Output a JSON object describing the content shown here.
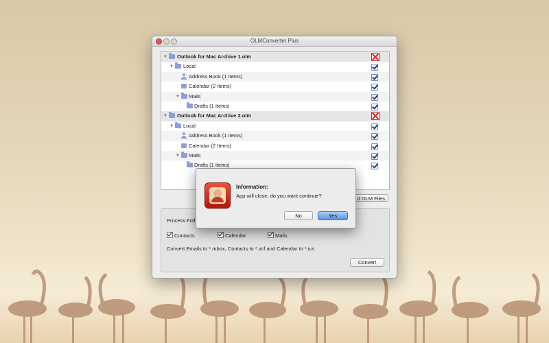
{
  "window": {
    "title": "OLMConverter Plus"
  },
  "tree": {
    "rows": [
      {
        "type": "archive",
        "label": "Outlook for Mac Archive 1.olm",
        "icon": "folder-icon",
        "expander": "▼"
      },
      {
        "type": "folder",
        "label": "Local",
        "icon": "folder-icon",
        "expander": "▼"
      },
      {
        "type": "item",
        "label": "Address Book (1 Items)",
        "icon": "person-icon"
      },
      {
        "type": "item",
        "label": "Calendar (2 Items)",
        "icon": "calendar-icon"
      },
      {
        "type": "folder",
        "label": "Mails",
        "icon": "folder-icon",
        "expander": "▼"
      },
      {
        "type": "item",
        "label": "Drafts (1 Items)",
        "icon": "folder-icon"
      },
      {
        "type": "archive",
        "label": "Outlook for Mac Archive 2.olm",
        "icon": "folder-icon",
        "expander": "▼"
      },
      {
        "type": "folder",
        "label": "Local",
        "icon": "folder-icon",
        "expander": "▼"
      },
      {
        "type": "item",
        "label": "Address Book (1 Items)",
        "icon": "person-icon"
      },
      {
        "type": "item",
        "label": "Calendar (2 Items)",
        "icon": "calendar-icon"
      },
      {
        "type": "folder",
        "label": "Mails",
        "icon": "folder-icon",
        "expander": "▼"
      },
      {
        "type": "item",
        "label": "Drafts (1 Items)",
        "icon": "folder-icon"
      }
    ]
  },
  "add_button_label": "d OLM Files",
  "process_panel": {
    "title": "Process Foll",
    "options": [
      {
        "label": "Contacts",
        "checked": true
      },
      {
        "label": "Calendar",
        "checked": true
      },
      {
        "label": "Mails",
        "checked": true
      }
    ],
    "description": "Convert Emails to *.mbox, Contacts to *.vcf and Calendar to *.ics",
    "convert_label": "Convert"
  },
  "dialog": {
    "title": "Information:",
    "message": "App will close, do you want continue?",
    "no_label": "No",
    "yes_label": "Yes"
  },
  "colors": {
    "accent_blue": "#5a97e0",
    "folder_icon": "#8e9fd6",
    "remove_red": "#d22222"
  }
}
